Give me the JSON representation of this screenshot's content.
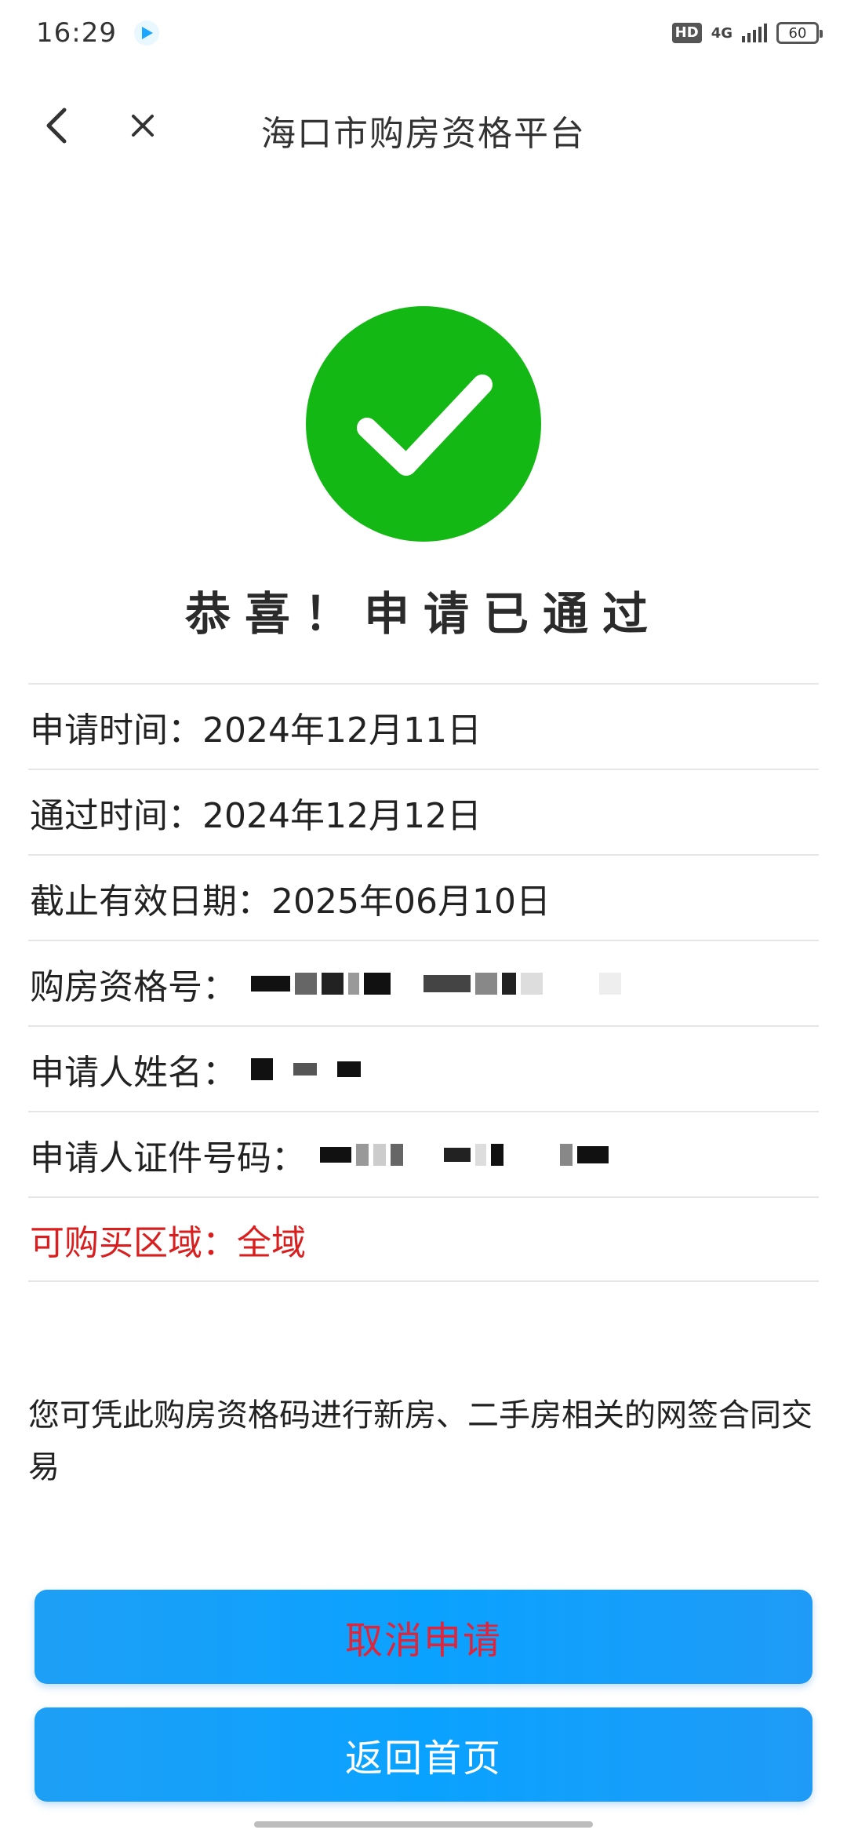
{
  "status_bar": {
    "time": "16:29",
    "network": "4G",
    "hd": "HD",
    "battery": "60"
  },
  "nav": {
    "title": "海口市购房资格平台"
  },
  "result": {
    "title": "恭喜！申请已通过",
    "icon": "check-circle-icon",
    "icon_color": "#14b814"
  },
  "info": {
    "apply_time": "申请时间：2024年12月11日",
    "pass_time": "通过时间：2024年12月12日",
    "expire_date": "截止有效日期：2025年06月10日",
    "qualification_no_label": "购房资格号：",
    "applicant_name_label": "申请人姓名：",
    "applicant_id_label": "申请人证件号码：",
    "purchase_area": "可购买区域：全域"
  },
  "notice": "您可凭此购房资格码进行新房、二手房相关的网签合同交易",
  "buttons": {
    "cancel": "取消申请",
    "home": "返回首页"
  },
  "colors": {
    "accent_blue": "#0aa2ff",
    "success_green": "#14b814",
    "warning_red": "#d81e1e"
  }
}
